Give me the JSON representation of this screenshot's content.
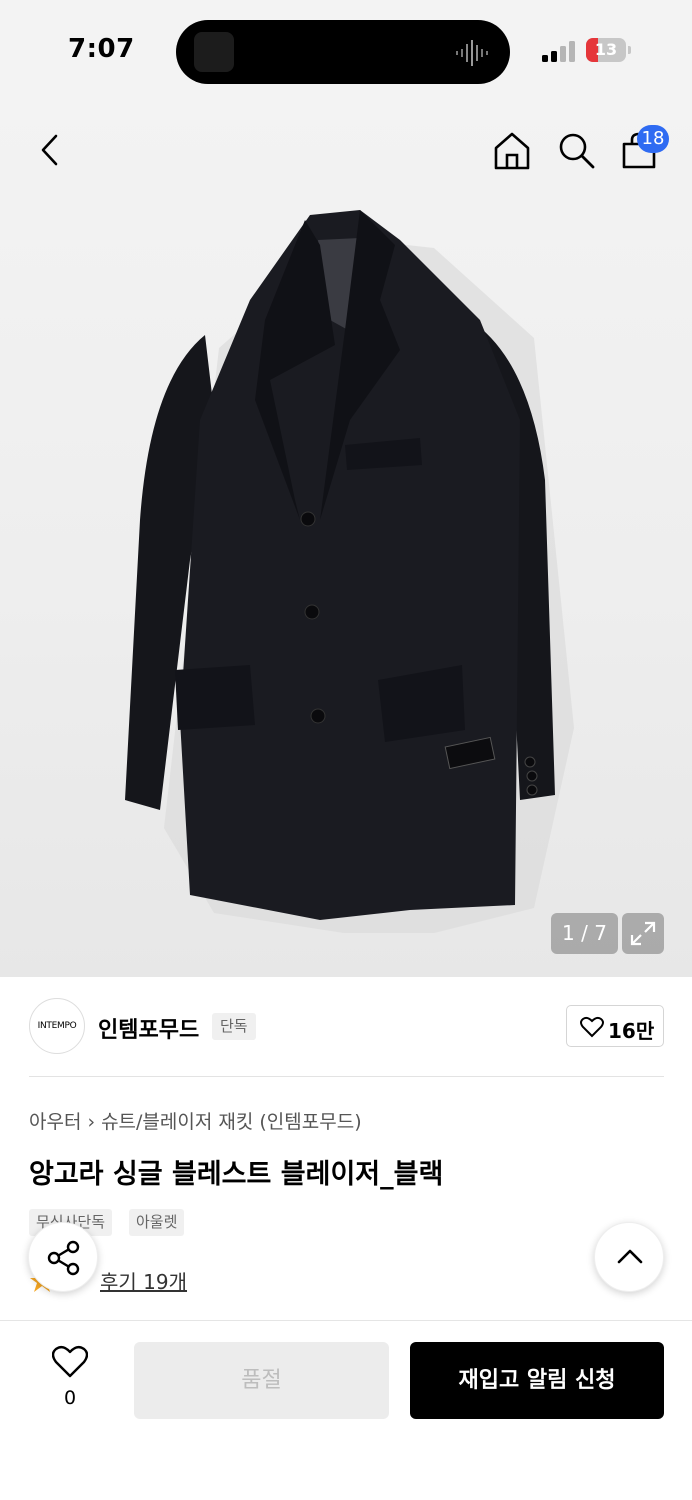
{
  "status_bar": {
    "time": "7:07",
    "battery": "13"
  },
  "header": {
    "back_icon": "chevron-left-icon",
    "home_icon": "home-icon",
    "search_icon": "search-icon",
    "cart_icon": "shopping-bag-icon",
    "cart_count": "18"
  },
  "gallery": {
    "counter": "1 / 7",
    "expand_icon": "expand-icon"
  },
  "brand": {
    "logo_text": "INTEMPO",
    "name": "인템포무드",
    "tag": "단독",
    "like_count": "16만"
  },
  "product": {
    "breadcrumb": [
      "아우터",
      "슈트/블레이저 재킷 (인템포무드)"
    ],
    "title": "앙고라 싱글 블레스트 블레이저_블랙",
    "tags": [
      "무신사단독",
      "아울렛"
    ],
    "review_link": "후기 19개"
  },
  "fab": {
    "share_icon": "share-icon",
    "top_icon": "chevron-up-icon"
  },
  "bottom_bar": {
    "wish_count": "0",
    "soldout_label": "품절",
    "restock_label": "재입고 알림 신청"
  },
  "colors": {
    "accent_blue": "#2f6bf2",
    "primary": "#000000",
    "disabled": "#ececec",
    "star": "#f5a623"
  }
}
